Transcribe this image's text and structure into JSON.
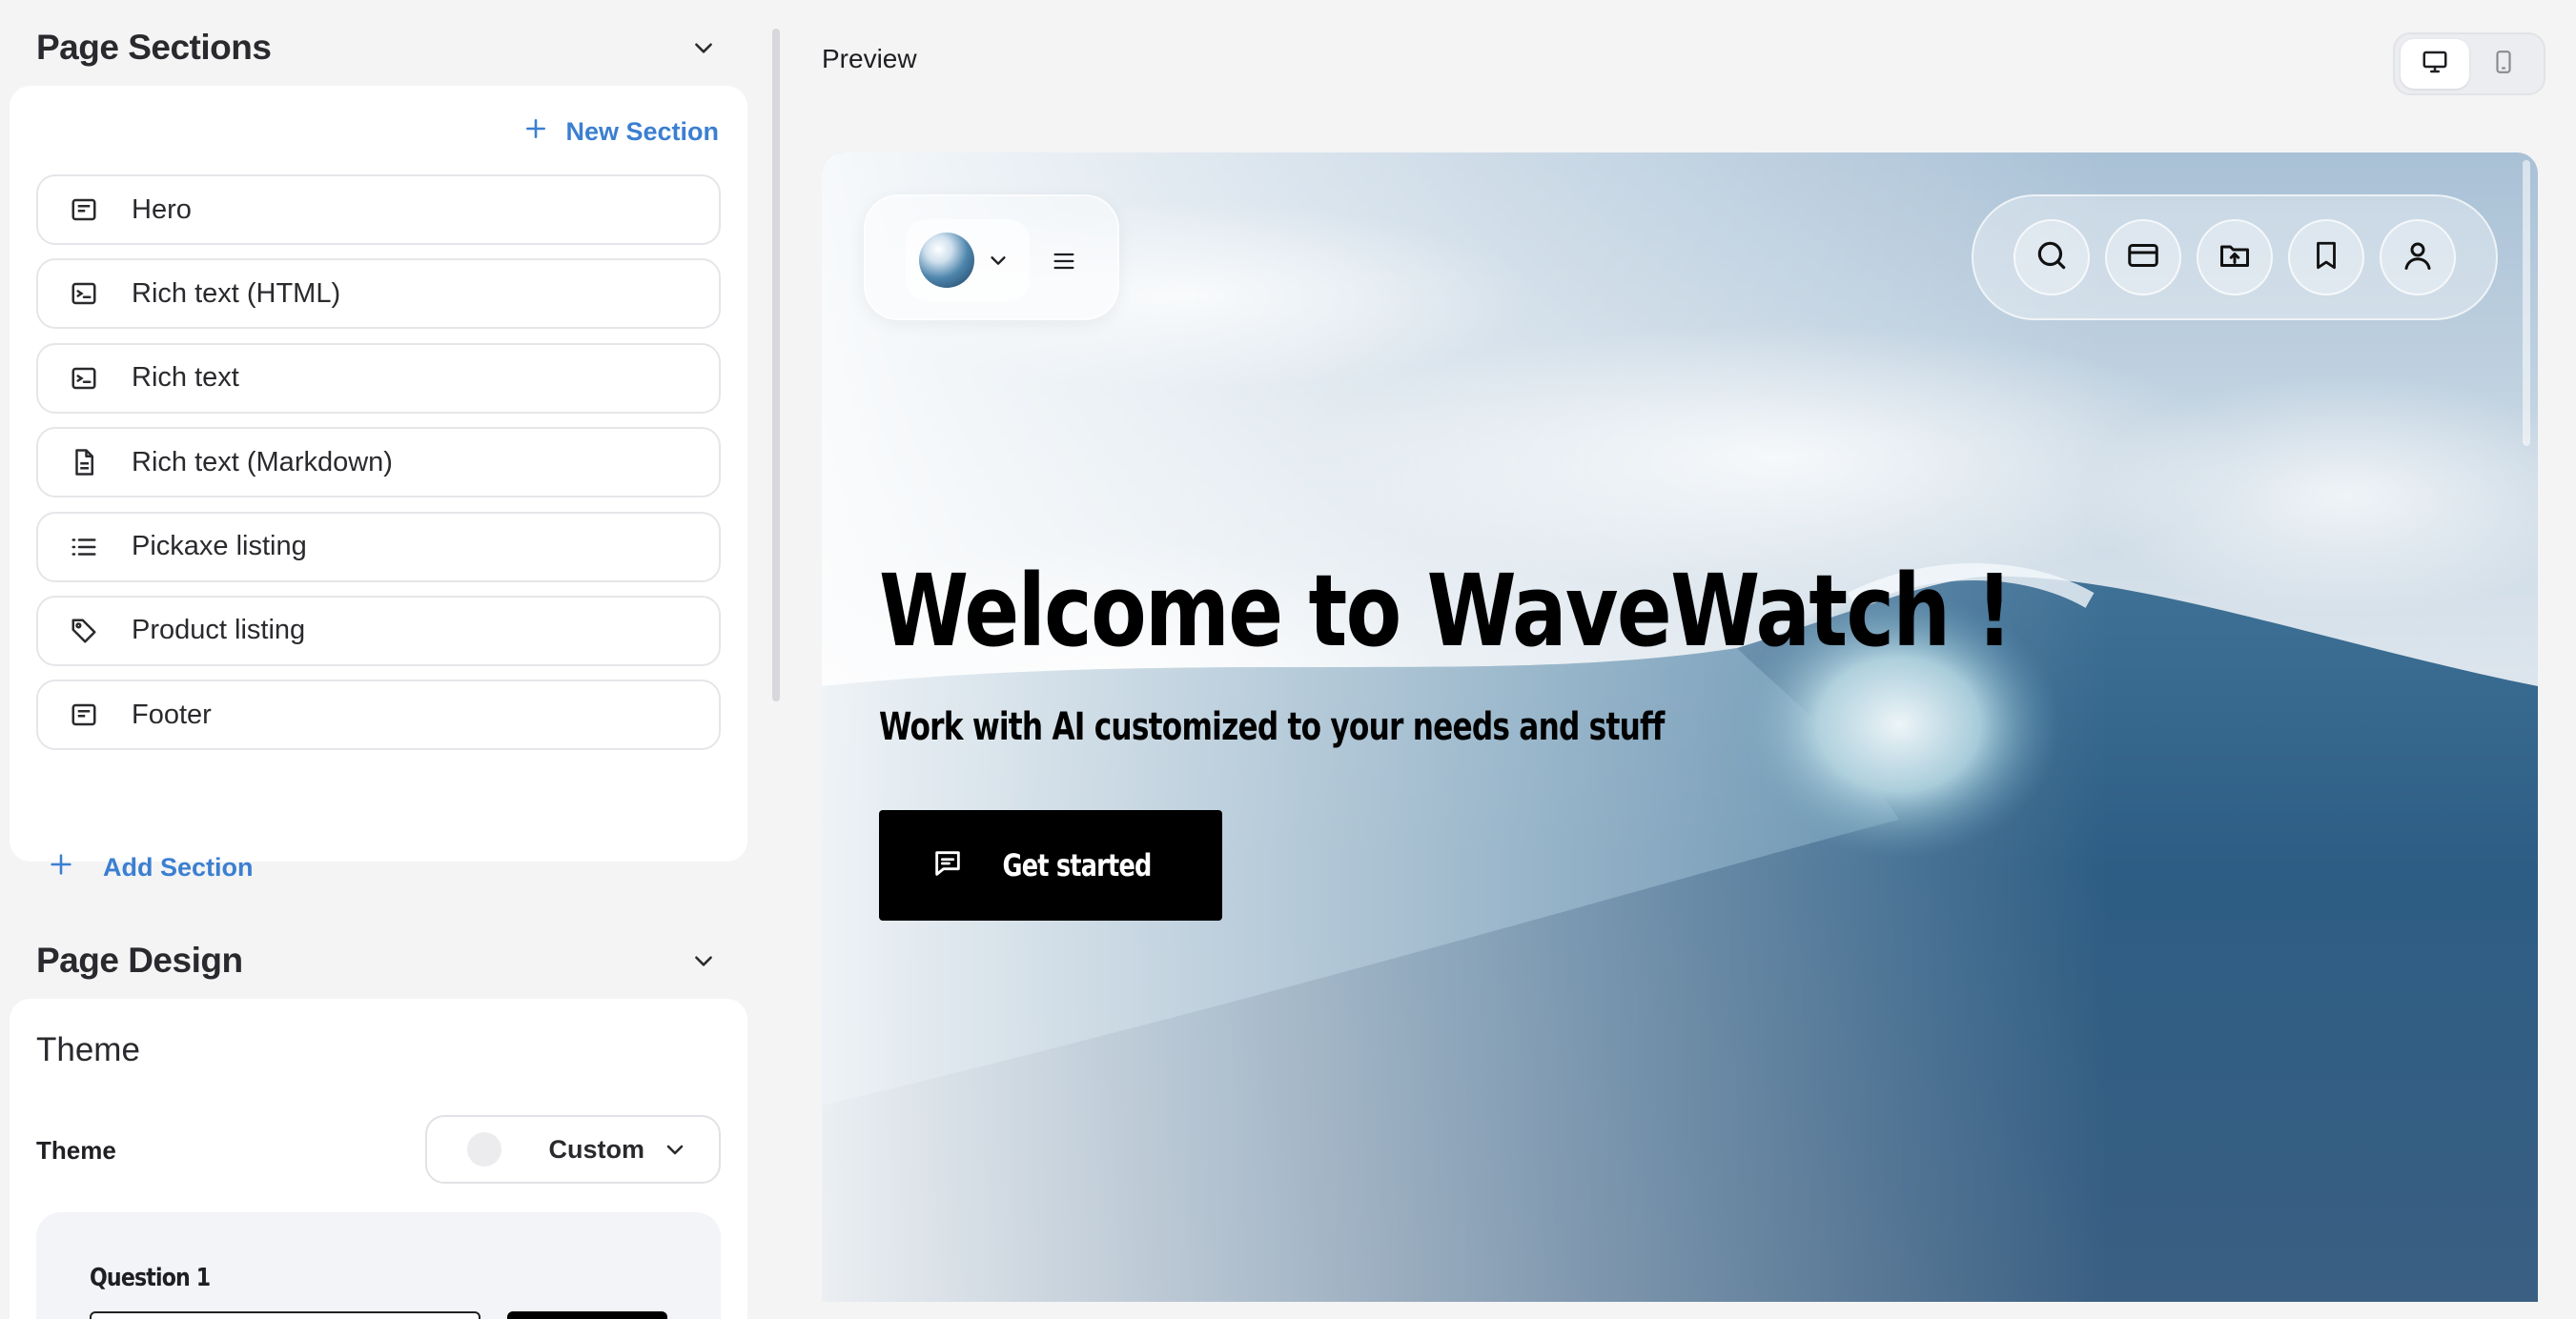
{
  "page_sections": {
    "title": "Page Sections",
    "new_section_label": "New Section",
    "items": [
      {
        "label": "Hero",
        "icon": "section-layout-icon"
      },
      {
        "label": "Rich text (HTML)",
        "icon": "terminal-icon"
      },
      {
        "label": "Rich text",
        "icon": "terminal-icon"
      },
      {
        "label": "Rich text (Markdown)",
        "icon": "document-icon"
      },
      {
        "label": "Pickaxe listing",
        "icon": "list-icon"
      },
      {
        "label": "Product listing",
        "icon": "tag-icon"
      },
      {
        "label": "Footer",
        "icon": "section-layout-icon"
      }
    ],
    "add_section_label": "Add Section"
  },
  "page_design": {
    "title": "Page Design",
    "theme_heading": "Theme",
    "theme_label": "Theme",
    "theme_value": "Custom",
    "question_label": "Question 1"
  },
  "preview": {
    "label": "Preview",
    "device_active": "desktop",
    "hero": {
      "title": "Welcome to WaveWatch !",
      "subtitle": "Work with AI customized to your needs and stuff",
      "cta_label": "Get started"
    }
  },
  "colors": {
    "accent": "#3b7fd1",
    "background": "#f4f4f5",
    "card": "#ffffff",
    "cta": "#000000"
  }
}
